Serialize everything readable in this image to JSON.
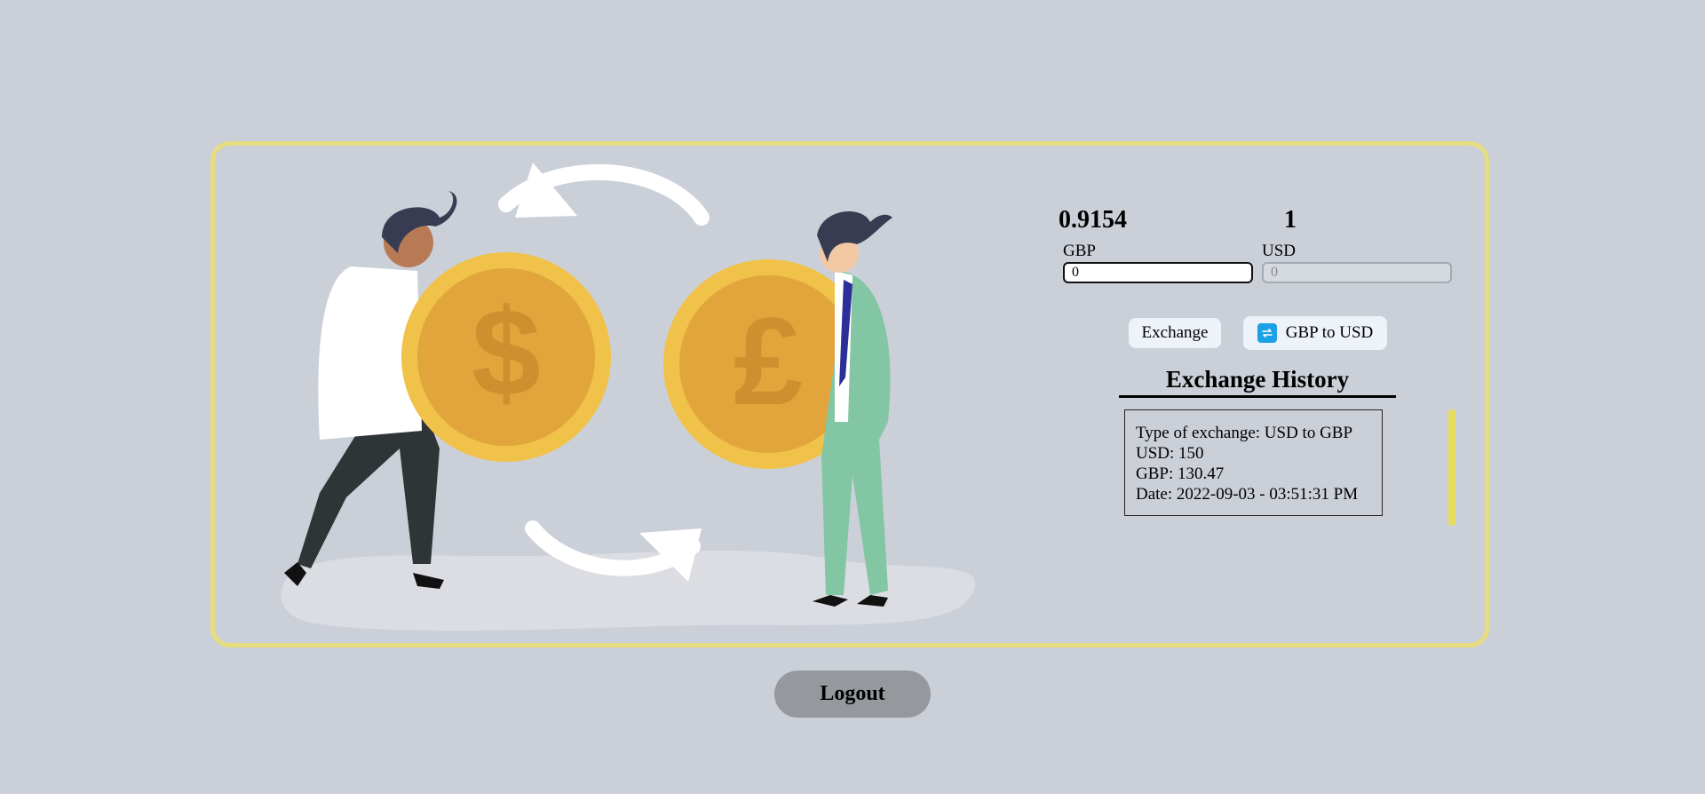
{
  "rates": {
    "left": "0.9154",
    "right": "1"
  },
  "currencies": {
    "from_label": "GBP",
    "to_label": "USD"
  },
  "inputs": {
    "from_value": "0",
    "to_value": "0"
  },
  "buttons": {
    "exchange_label": "Exchange",
    "direction_label": "GBP to USD",
    "logout_label": "Logout"
  },
  "history": {
    "title": "Exchange History",
    "entries": [
      {
        "type": "Type of exchange: USD to GBP",
        "usd": "USD: 150",
        "gbp": "GBP: 130.47",
        "date": "Date: 2022-09-03 - 03:51:31 PM"
      }
    ]
  },
  "colors": {
    "background": "#cbd0d8",
    "card_border": "#e7dc7e",
    "coin": "#f0c24a",
    "scrollbar": "#e6dd5c",
    "swap_icon": "#1da1e6",
    "logout_button": "#95989d"
  },
  "illustration": {
    "icon": "currency-exchange-illustration",
    "symbols": [
      "$",
      "£"
    ]
  }
}
